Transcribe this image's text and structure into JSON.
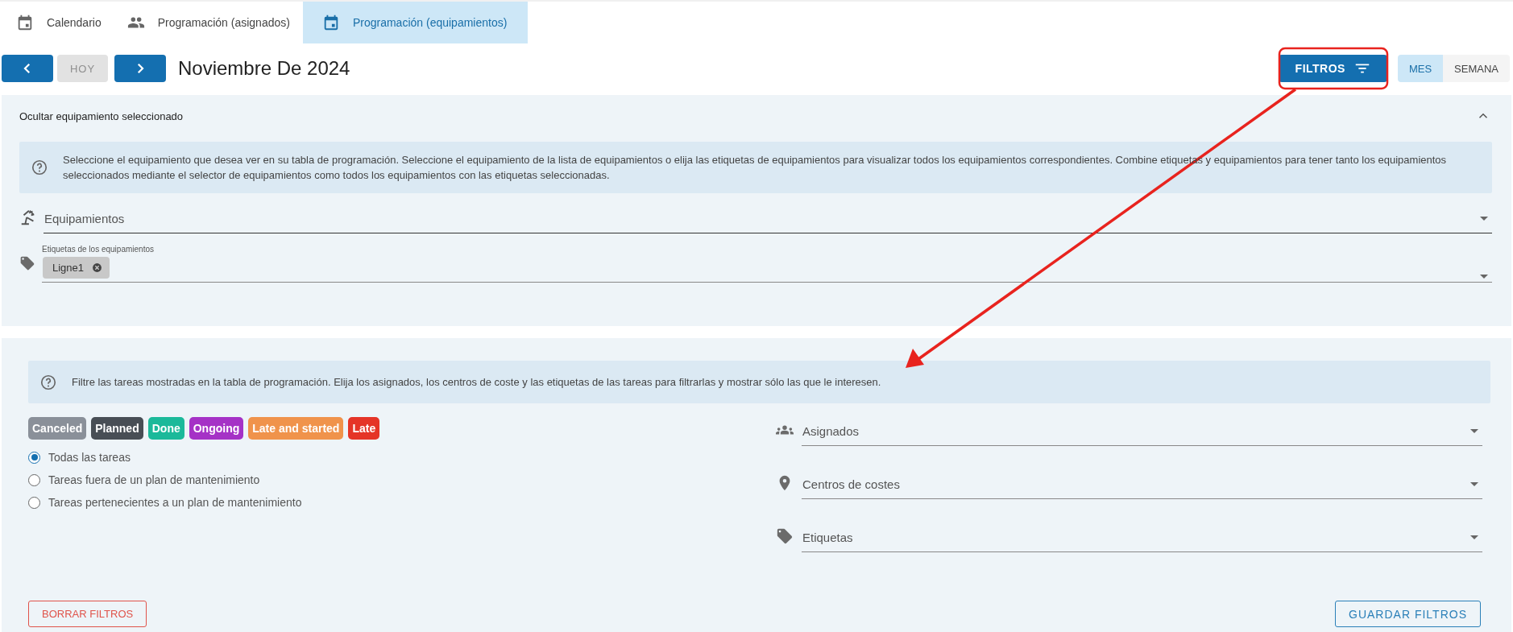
{
  "tabs": [
    {
      "label": "Calendario",
      "selected": false
    },
    {
      "label": "Programación (asignados)",
      "selected": false
    },
    {
      "label": "Programación (equipamientos)",
      "selected": true
    }
  ],
  "toolbar": {
    "today_button": {
      "label": "HOY",
      "disabled": true
    },
    "title": "Noviembre De 2024",
    "filters_button": "FILTROS",
    "view_toggle": [
      {
        "label": "MES",
        "selected": true
      },
      {
        "label": "SEMANA",
        "selected": false
      }
    ]
  },
  "equipment_panel": {
    "header": "Ocultar equipamiento seleccionado",
    "expanded": true,
    "info": "Seleccione el equipamiento que desea ver en su tabla de programación. Seleccione el equipamiento de la lista de equipamientos o elija las etiquetas de equipamientos para visualizar todos los equipamientos correspondientes. Combine etiquetas y equipamientos para tener tanto los equipamientos seleccionados mediante el selector de equipamientos como todos los equipamientos con las etiquetas seleccionadas.",
    "equipment_field": {
      "placeholder": "Equipamientos"
    },
    "tags_field": {
      "label": "Etiquetas de los equipamientos",
      "chips": [
        "Ligne1"
      ]
    }
  },
  "task_panel": {
    "info": "Filtre las tareas mostradas en la tabla de programación. Elija los asignados, los centros de coste y las etiquetas de las tareas para filtrarlas y mostrar sólo las que le interesen.",
    "status_chips": [
      {
        "label": "Canceled",
        "color": "#8a9099"
      },
      {
        "label": "Planned",
        "color": "#484e55"
      },
      {
        "label": "Done",
        "color": "#1bb99a"
      },
      {
        "label": "Ongoing",
        "color": "#a532c6"
      },
      {
        "label": "Late and started",
        "color": "#f0934b"
      },
      {
        "label": "Late",
        "color": "#e53427"
      }
    ],
    "task_scope": [
      {
        "label": "Todas las tareas",
        "selected": true
      },
      {
        "label": "Tareas fuera de un plan de mantenimiento",
        "selected": false
      },
      {
        "label": "Tareas pertenecientes a un plan de mantenimiento",
        "selected": false
      }
    ],
    "fields": [
      {
        "placeholder": "Asignados"
      },
      {
        "placeholder": "Centros de costes"
      },
      {
        "placeholder": "Etiquetas"
      }
    ],
    "clear_button": "BORRAR FILTROS",
    "save_button": "GUARDAR FILTROS"
  },
  "annotations": {
    "highlight_box": true,
    "arrow": true
  }
}
